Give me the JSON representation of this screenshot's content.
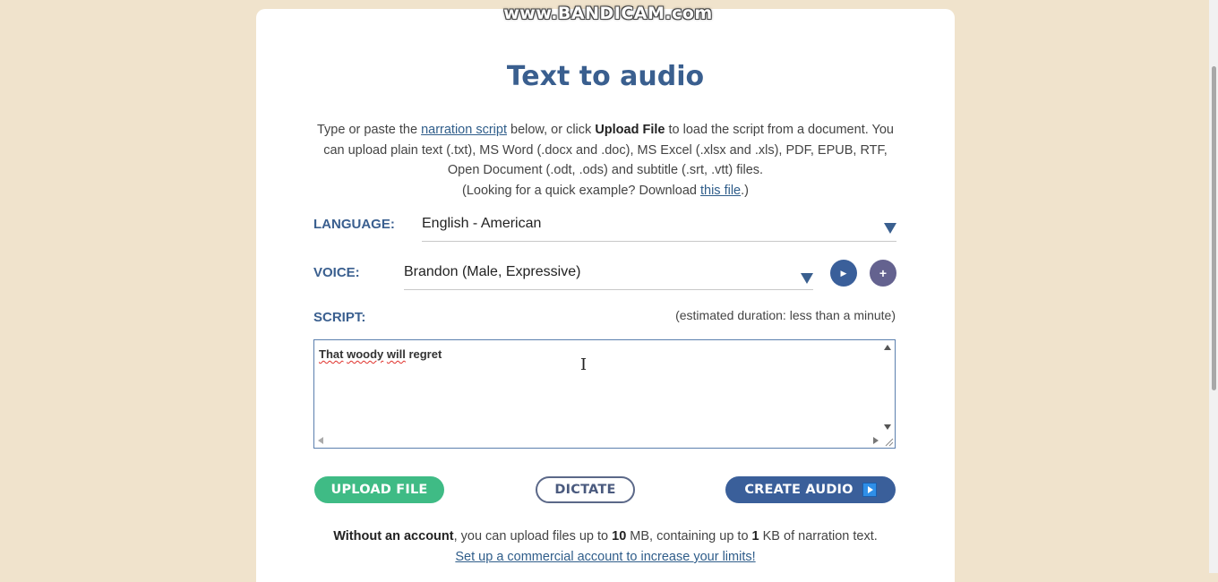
{
  "watermark": "www.BANDICAM.com",
  "page": {
    "title": "Text to audio",
    "intro": {
      "t1": "Type or paste the ",
      "link1": "narration script",
      "t2": " below, or click ",
      "bold1": "Upload File",
      "t3": " to load the script from a document. You can upload plain text (.txt), MS Word (.docx and .doc), MS Excel (.xlsx and .xls), PDF, EPUB, RTF, Open Document (.odt, .ods) and subtitle (.srt, .vtt) files.",
      "t4": "(Looking for a quick example? Download ",
      "link2": "this file",
      "t5": ".)"
    }
  },
  "language": {
    "label": "LANGUAGE:",
    "value": "English - American"
  },
  "voice": {
    "label": "VOICE:",
    "value": "Brandon (Male, Expressive)",
    "play_glyph": "▶",
    "add_glyph": "+"
  },
  "script": {
    "label": "SCRIPT:",
    "duration": "(estimated duration: less than a minute)",
    "text_parts": [
      "That",
      " ",
      "woody",
      " ",
      "will",
      " regret"
    ],
    "cursor_glyph": "I"
  },
  "actions": {
    "upload": "UPLOAD FILE",
    "dictate": "DICTATE",
    "create": "CREATE AUDIO"
  },
  "limits": {
    "bold1": "Without an account",
    "t1": ", you can upload files up to ",
    "size": "10",
    "t2": " MB, containing up to ",
    "kb": "1",
    "t3": " KB of narration text.",
    "link": "Set up a commercial account to increase your limits!"
  },
  "colors": {
    "background": "#f0e3cc",
    "accent_blue": "#3a5f8f",
    "upload_green": "#3fbb85",
    "create_blue": "#3a5f9a",
    "add_purple": "#64628f"
  },
  "icons": {
    "language_dropdown": "chevron-down-icon",
    "voice_dropdown": "chevron-down-icon",
    "preview_voice": "play-icon",
    "add_voice": "plus-icon",
    "create_audio": "play-icon"
  }
}
